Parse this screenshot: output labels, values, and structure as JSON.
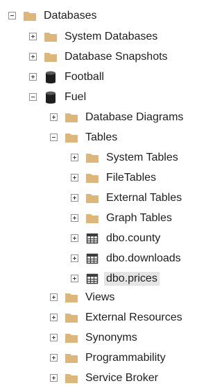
{
  "tree": {
    "root": {
      "label": "Databases",
      "state": "expanded",
      "icon": "folder-icon"
    },
    "system_databases": {
      "label": "System Databases",
      "state": "collapsed",
      "icon": "folder-icon"
    },
    "database_snapshots": {
      "label": "Database Snapshots",
      "state": "collapsed",
      "icon": "folder-icon"
    },
    "football": {
      "label": "Football",
      "state": "collapsed",
      "icon": "database-icon"
    },
    "fuel": {
      "label": "Fuel",
      "state": "expanded",
      "icon": "database-icon"
    },
    "database_diagrams": {
      "label": "Database Diagrams",
      "state": "collapsed",
      "icon": "folder-icon"
    },
    "tables": {
      "label": "Tables",
      "state": "expanded",
      "icon": "folder-icon"
    },
    "system_tables": {
      "label": "System Tables",
      "state": "collapsed",
      "icon": "folder-icon"
    },
    "filetables": {
      "label": "FileTables",
      "state": "collapsed",
      "icon": "folder-icon"
    },
    "external_tables": {
      "label": "External Tables",
      "state": "collapsed",
      "icon": "folder-icon"
    },
    "graph_tables": {
      "label": "Graph Tables",
      "state": "collapsed",
      "icon": "folder-icon"
    },
    "table_county": {
      "label": "dbo.county",
      "state": "collapsed",
      "icon": "table-icon"
    },
    "table_downloads": {
      "label": "dbo.downloads",
      "state": "collapsed",
      "icon": "table-icon"
    },
    "table_prices": {
      "label": "dbo.prices",
      "state": "collapsed",
      "icon": "table-icon",
      "selected": true
    },
    "views": {
      "label": "Views",
      "state": "collapsed",
      "icon": "folder-icon"
    },
    "external_resources": {
      "label": "External Resources",
      "state": "collapsed",
      "icon": "folder-icon"
    },
    "synonyms": {
      "label": "Synonyms",
      "state": "collapsed",
      "icon": "folder-icon"
    },
    "programmability": {
      "label": "Programmability",
      "state": "collapsed",
      "icon": "folder-icon"
    },
    "service_broker": {
      "label": "Service Broker",
      "state": "collapsed",
      "icon": "folder-icon"
    }
  },
  "colors": {
    "folder": "#dcb67a",
    "database": "#1e1e1e",
    "table_grid": "#3c3c3c",
    "selection": "#e5e5e5",
    "expander_border": "#919191"
  }
}
